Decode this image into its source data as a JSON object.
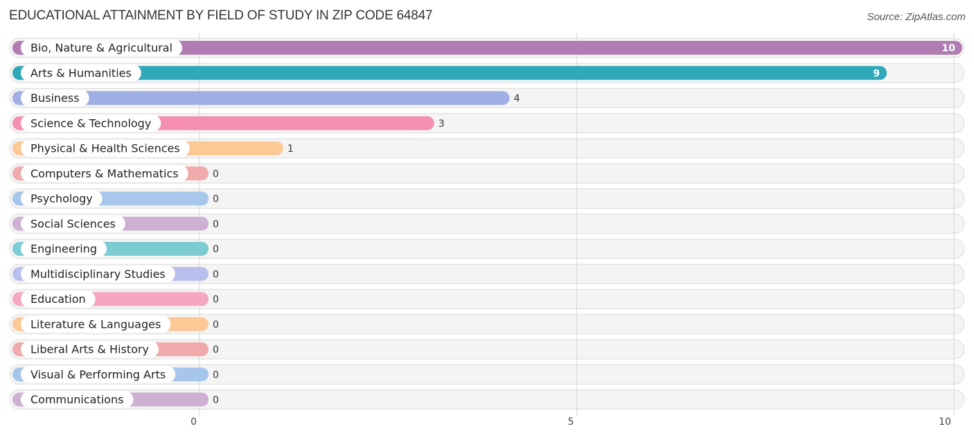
{
  "header": {
    "title": "EDUCATIONAL ATTAINMENT BY FIELD OF STUDY IN ZIP CODE 64847",
    "source": "Source: ZipAtlas.com"
  },
  "chart_data": {
    "type": "bar",
    "orientation": "horizontal",
    "title": "EDUCATIONAL ATTAINMENT BY FIELD OF STUDY IN ZIP CODE 64847",
    "xlabel": "",
    "ylabel": "",
    "xlim": [
      0,
      10
    ],
    "xticks": [
      0,
      5,
      10
    ],
    "grid": true,
    "categories": [
      "Bio, Nature & Agricultural",
      "Arts & Humanities",
      "Business",
      "Science & Technology",
      "Physical & Health Sciences",
      "Computers & Mathematics",
      "Psychology",
      "Social Sciences",
      "Engineering",
      "Multidisciplinary Studies",
      "Education",
      "Literature & Languages",
      "Liberal Arts & History",
      "Visual & Performing Arts",
      "Communications"
    ],
    "values": [
      10,
      9,
      4,
      3,
      1,
      0,
      0,
      0,
      0,
      0,
      0,
      0,
      0,
      0,
      0
    ],
    "colors": [
      "#b07db3",
      "#2fa9b9",
      "#a0aee6",
      "#f58fb0",
      "#fbc896",
      "#f0aaab",
      "#a7c6ec",
      "#cdb0d2",
      "#7dccd1",
      "#b8bfec",
      "#f5a7c2",
      "#fbc896",
      "#f0aaab",
      "#a7c6ec",
      "#cdb0d2"
    ]
  }
}
